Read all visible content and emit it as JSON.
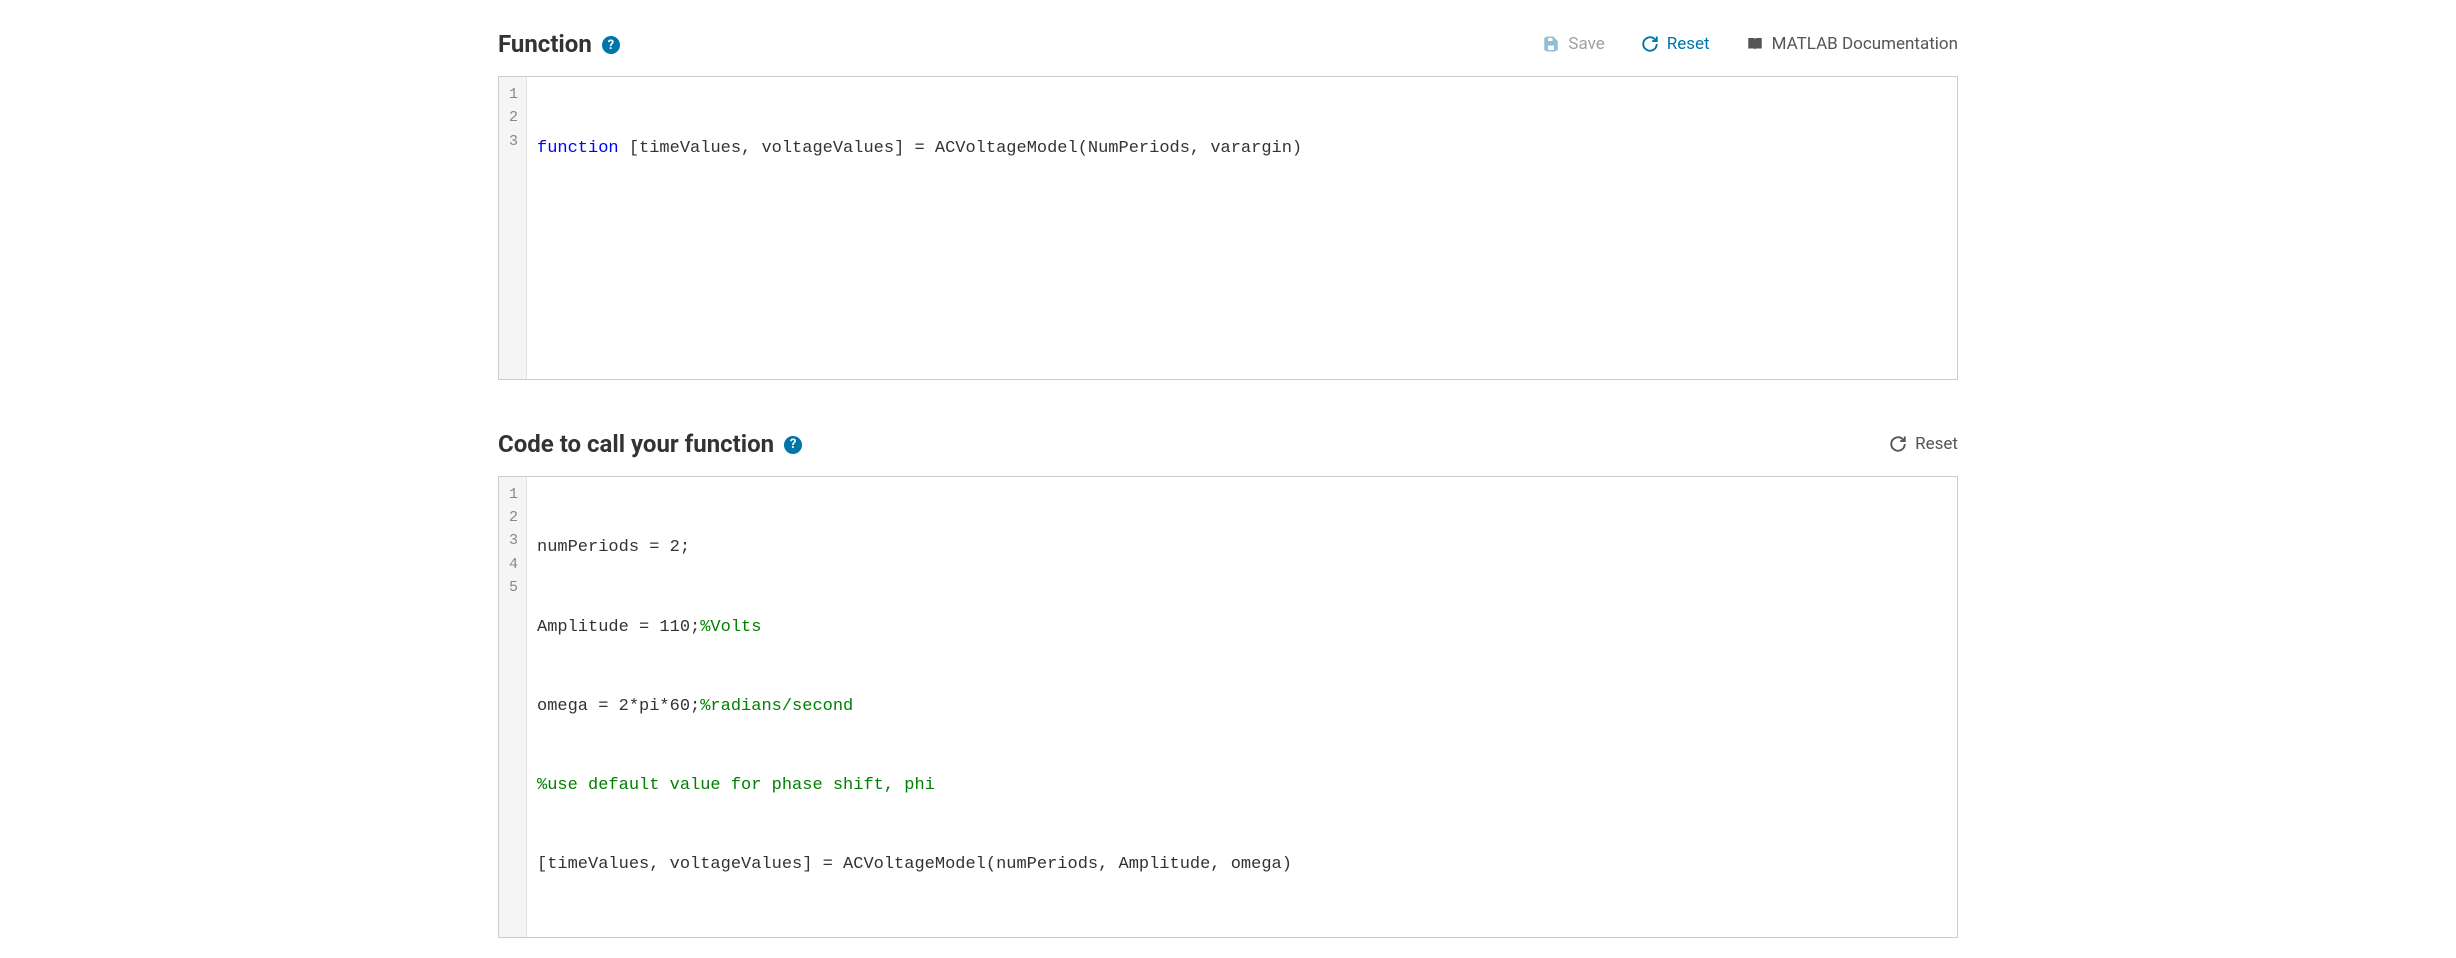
{
  "section1": {
    "title": "Function",
    "toolbar": {
      "save": "Save",
      "reset": "Reset",
      "docs": "MATLAB Documentation"
    },
    "lineNumbers": [
      "1",
      "2",
      "3"
    ],
    "code": {
      "line1_kw": "function",
      "line1_rest": " [timeValues, voltageValues] = ACVoltageModel(NumPeriods, varargin)",
      "line2": "",
      "line3": ""
    }
  },
  "section2": {
    "title": "Code to call your function",
    "toolbar": {
      "reset": "Reset"
    },
    "lineNumbers": [
      "1",
      "2",
      "3",
      "4",
      "5"
    ],
    "code": {
      "line1": "numPeriods = 2;",
      "line2_a": "Amplitude = 110;",
      "line2_c": "%Volts",
      "line3_a": "omega = 2*pi*60;",
      "line3_c": "%radians/second",
      "line4_c": "%use default value for phase shift, phi",
      "line5": "[timeValues, voltageValues] = ACVoltageModel(numPeriods, Amplitude, omega)"
    }
  }
}
